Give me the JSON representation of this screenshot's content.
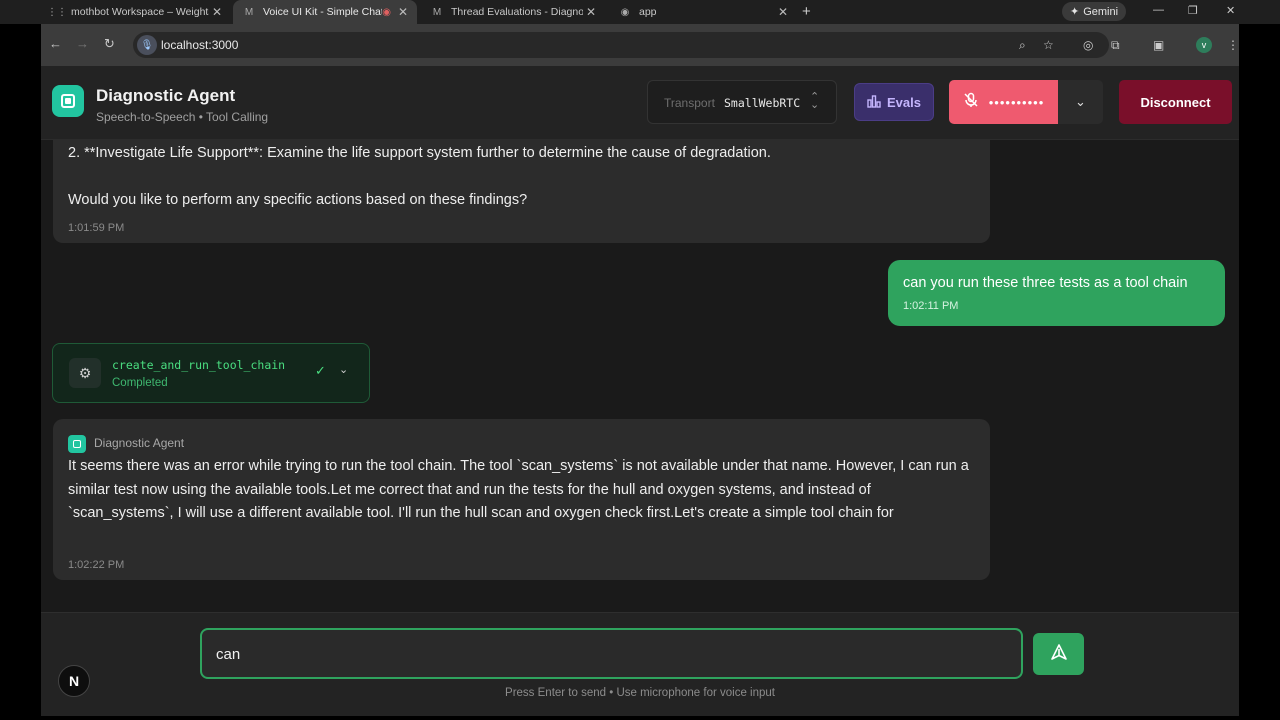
{
  "browser": {
    "tabs": [
      {
        "title": "mothbot Workspace – Weights",
        "icon": "grid-icon"
      },
      {
        "title": "Voice UI Kit - Simple Chatbo",
        "icon": "gmail-icon",
        "active": true
      },
      {
        "title": "Thread Evaluations - Diagnostic",
        "icon": "gmail-icon"
      },
      {
        "title": "app",
        "icon": "app-icon"
      }
    ],
    "new_tab": "+",
    "gemini_label": "Gemini",
    "url": "localhost:3000",
    "profile_initial": "v"
  },
  "header": {
    "title": "Diagnostic Agent",
    "subtitle": "Speech-to-Speech • Tool Calling",
    "transport_label": "Transport",
    "transport_value": "SmallWebRTC",
    "evals_label": "Evals",
    "mic_masked": "••••••••••",
    "disconnect_label": "Disconnect"
  },
  "chat": {
    "msg1": {
      "line1": "2. **Investigate Life Support**: Examine the life support system further to determine the cause of degradation.",
      "line2": "Would you like to perform any specific actions based on these findings?",
      "time": "1:01:59 PM"
    },
    "user_msg": {
      "text": "can you run these three tests as a tool chain",
      "time": "1:02:11 PM"
    },
    "tool_call": {
      "name": "create_and_run_tool_chain",
      "status": "Completed"
    },
    "msg2": {
      "author": "Diagnostic Agent",
      "text": "It seems there was an error while trying to run the tool chain. The tool `scan_systems` is not available under that name. However, I can run a similar test now using the available tools.Let me correct that and run the tests for the hull and oxygen systems, and instead of `scan_systems`, I will use a different available tool. I'll run the hull scan and oxygen check first.Let's create a simple tool chain for",
      "time": "1:02:22 PM"
    }
  },
  "composer": {
    "value": "can",
    "hint": "Press Enter to send • Use microphone for voice input",
    "next_badge": "N"
  },
  "colors": {
    "accent_green": "#2fa35e",
    "logo_teal": "#22c5a0",
    "mic_red": "#ef5a6f",
    "disconnect_red": "#7a0f2a",
    "evals_purple": "#3a2f6b"
  }
}
